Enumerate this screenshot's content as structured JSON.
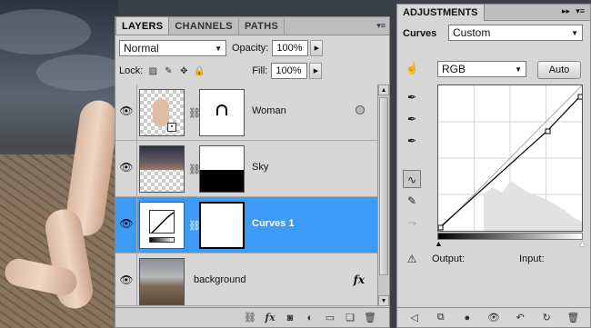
{
  "layers_panel": {
    "tabs": [
      "LAYERS",
      "CHANNELS",
      "PATHS"
    ],
    "blend_mode": "Normal",
    "opacity_label": "Opacity:",
    "opacity_value": "100%",
    "lock_label": "Lock:",
    "fill_label": "Fill:",
    "fill_value": "100%",
    "layers": [
      {
        "name": "Woman"
      },
      {
        "name": "Sky"
      },
      {
        "name": "Curves 1"
      },
      {
        "name": "background"
      }
    ]
  },
  "adjustments_panel": {
    "tab": "ADJUSTMENTS",
    "type_label": "Curves",
    "preset": "Custom",
    "channel": "RGB",
    "auto_label": "Auto",
    "output_label": "Output:",
    "input_label": "Input:"
  }
}
